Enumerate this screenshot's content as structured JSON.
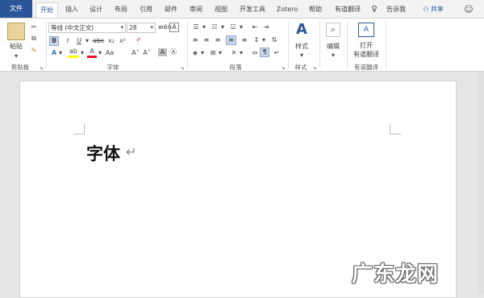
{
  "tabs": [
    "文件",
    "开始",
    "插入",
    "设计",
    "布局",
    "引用",
    "邮件",
    "审阅",
    "视图",
    "开发工具",
    "Zotero",
    "帮助",
    "有道翻译"
  ],
  "tell_me": "告诉我",
  "share": "共享",
  "clipboard": {
    "paste_label": "粘贴",
    "group_label": "剪贴板"
  },
  "font": {
    "font_name": "等线 (中文正文)",
    "font_size": "28",
    "bold": "B",
    "italic": "I",
    "underline": "U",
    "strike": "abc",
    "subscript": "x₂",
    "superscript": "x²",
    "grow": "A˄",
    "shrink": "A˅",
    "text_effects": "A",
    "highlight": "ab",
    "font_color": "A",
    "char_shading": "A",
    "encircle": "Ⓐ",
    "change_case": "Aa",
    "phonetic": "wén",
    "char_border": "A",
    "group_label": "字体",
    "accent_highlight": "#ffff00",
    "accent_font_color": "#e81123"
  },
  "paragraph": {
    "group_label": "段落"
  },
  "styles": {
    "label": "样式",
    "group_label": "样式"
  },
  "editing": {
    "label": "编辑"
  },
  "youdao": {
    "open_label": "打开",
    "line2": "有道翻译",
    "group_label": "有道翻译"
  },
  "document": {
    "text": "字体",
    "para_mark": "↵"
  },
  "watermark": "广东龙网",
  "colors": {
    "brand": "#2b579a"
  }
}
